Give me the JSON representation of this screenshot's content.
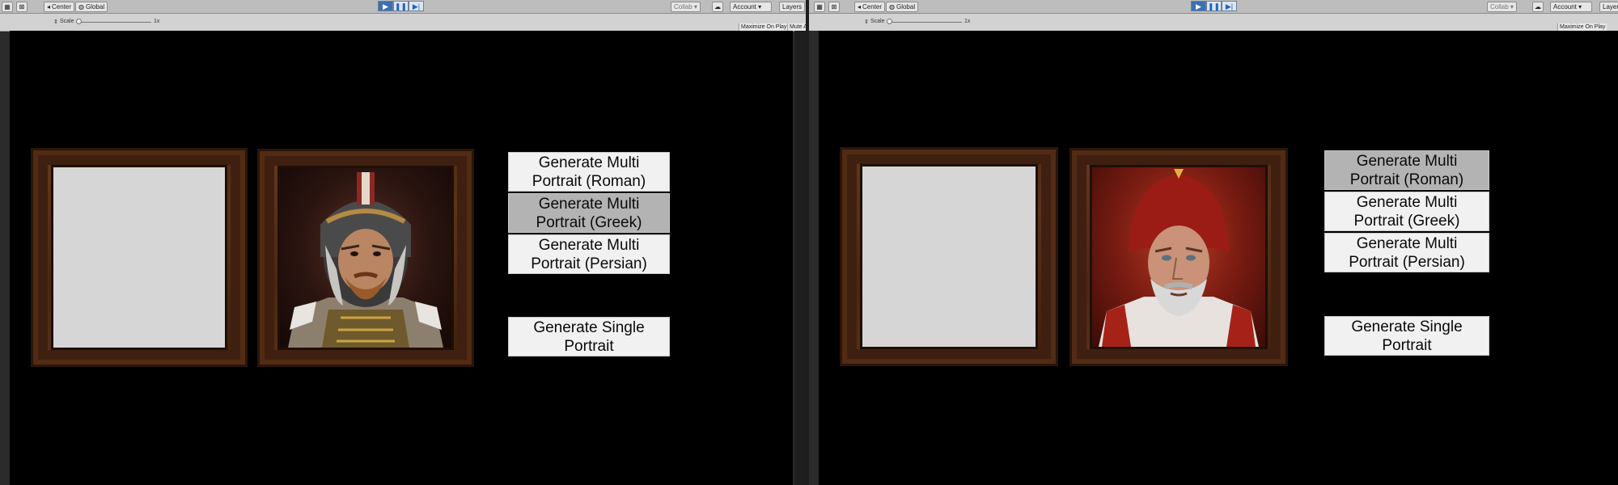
{
  "editor": {
    "toolbar": {
      "pivot_label": "Center",
      "space_label": "Global",
      "collab_label": "Collab ▾",
      "account_label": "Account ▾",
      "layers_label": "Layers"
    },
    "game_view": {
      "scale_label": "Scale",
      "scale_value": "1x",
      "maximize_label": "Maximize On Play",
      "mute_label": "Mute A"
    }
  },
  "panes": [
    {
      "selected_button": "greek",
      "portrait_subject": "roman-soldier-helmet",
      "buttons": {
        "roman": "Generate Multi Portrait (Roman)",
        "greek": "Generate Multi Portrait (Greek)",
        "persian": "Generate Multi Portrait (Persian)",
        "single": "Generate Single Portrait"
      }
    },
    {
      "selected_button": "roman",
      "portrait_subject": "red-capped-bearded-man",
      "buttons": {
        "roman": "Generate Multi Portrait (Roman)",
        "greek": "Generate Multi Portrait (Greek)",
        "persian": "Generate Multi Portrait (Persian)",
        "single": "Generate Single Portrait"
      }
    }
  ],
  "colors": {
    "game_background": "#000000",
    "button_background": "#f1f1f1",
    "button_selected": "#b3b3b3",
    "blank_canvas": "#d6d6d6",
    "frame_wood": "#4a2712"
  }
}
